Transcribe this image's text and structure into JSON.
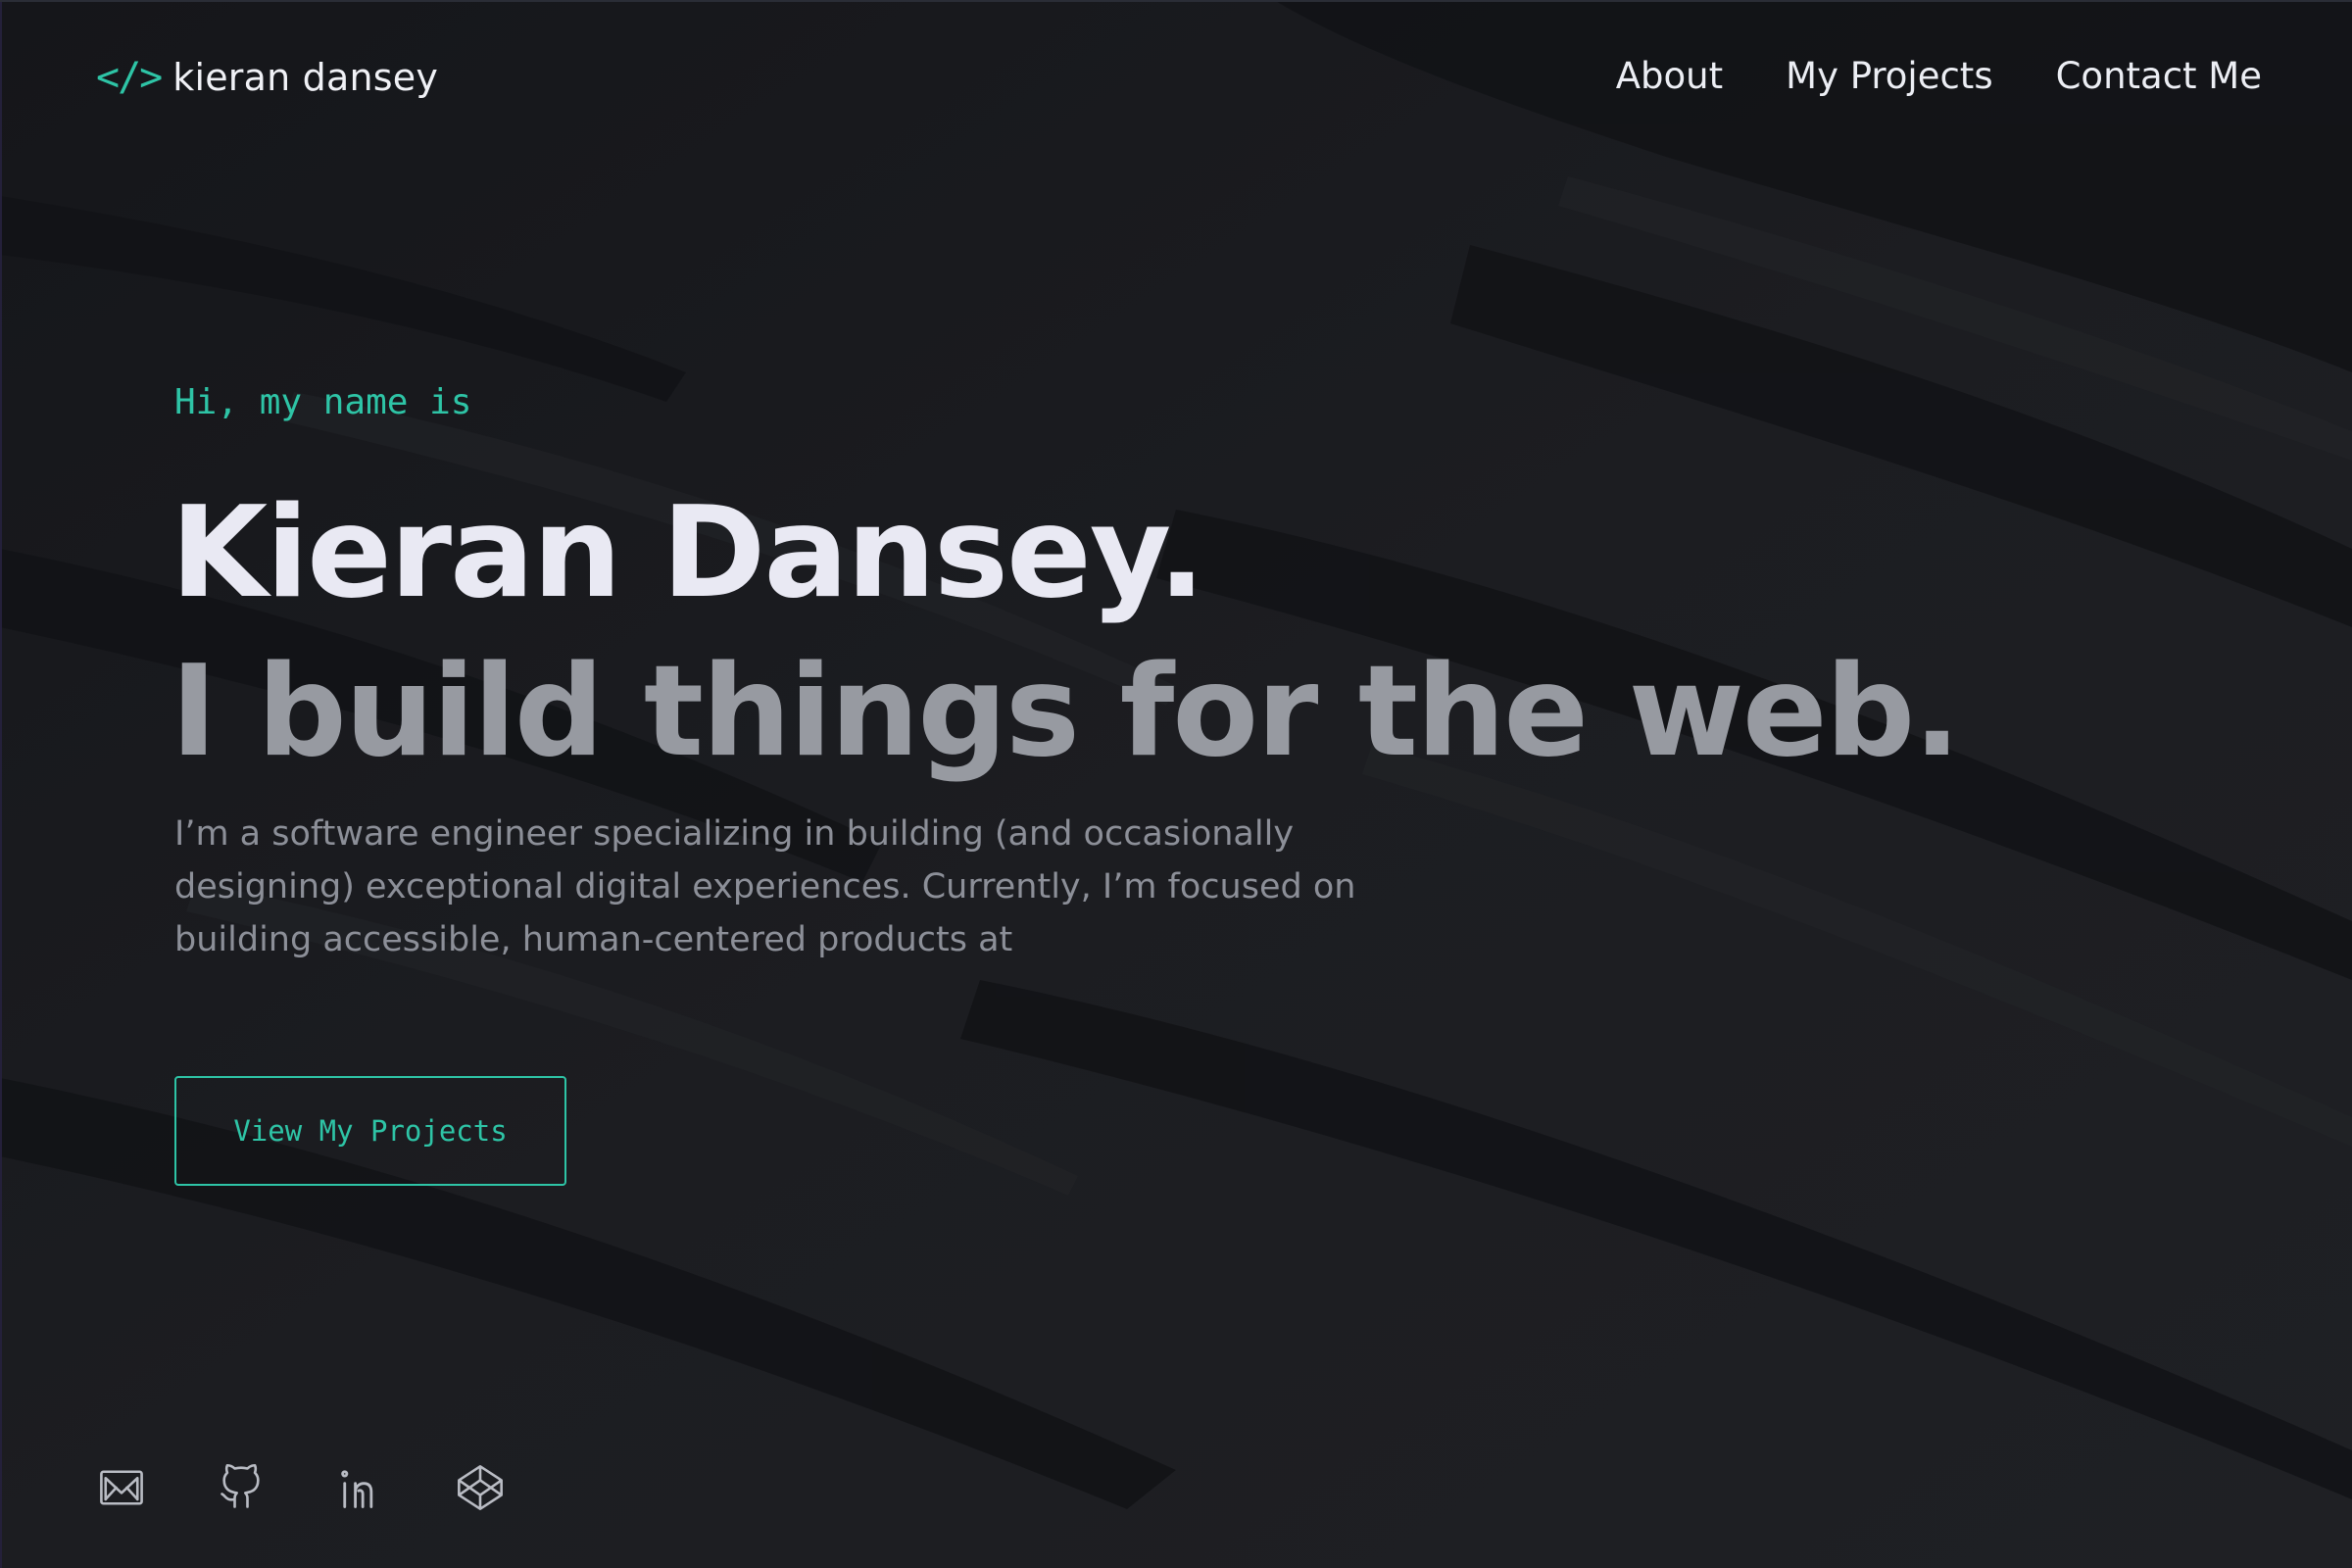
{
  "nav": {
    "logo_icon": "</>",
    "logo_text": "kieran dansey",
    "links": [
      {
        "label": "About"
      },
      {
        "label": "My Projects"
      },
      {
        "label": "Contact Me"
      }
    ]
  },
  "hero": {
    "greeting": "Hi, my name is",
    "name": "Kieran Dansey.",
    "tagline": "I build things for the web.",
    "description": "I’m a software engineer specializing in building (and occasionally designing) exceptional digital experiences. Currently, I’m focused on building accessible, human-centered products at",
    "cta_label": "View My Projects"
  },
  "socials": [
    {
      "icon": "mail-icon"
    },
    {
      "icon": "github-icon"
    },
    {
      "icon": "linkedin-icon"
    },
    {
      "icon": "codepen-icon"
    }
  ],
  "colors": {
    "background": "#16171b",
    "accent": "#2ec4a6",
    "heading": "#e9e9f3",
    "subheading": "#979aa1",
    "body": "#8c8f98"
  }
}
